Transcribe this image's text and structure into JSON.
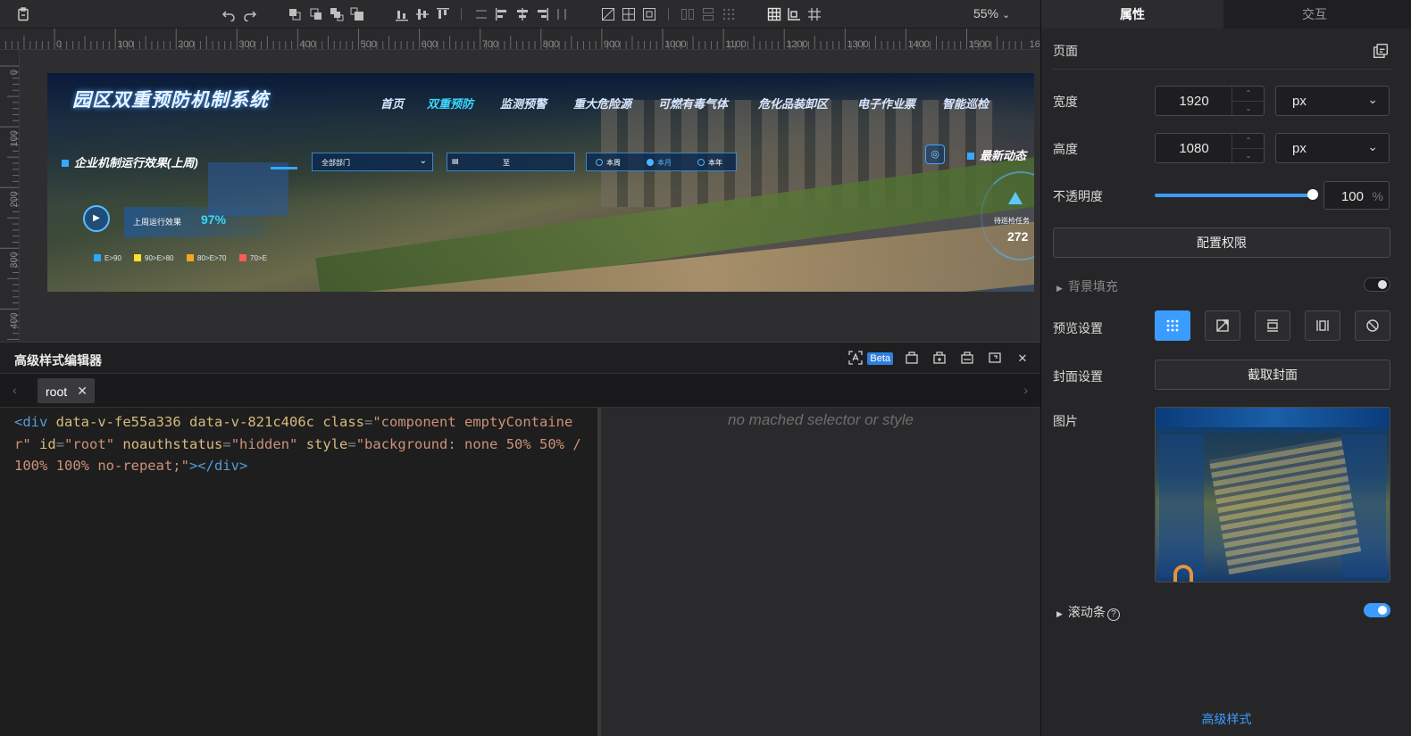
{
  "toolbar": {
    "zoom": "55%"
  },
  "ruler": {
    "top_labels": [
      "0",
      "100",
      "200",
      "300",
      "400",
      "500",
      "600",
      "700",
      "800",
      "900",
      "1000",
      "1100",
      "1200",
      "1300",
      "1400",
      "1500",
      "16"
    ],
    "left_labels": [
      "0",
      "100",
      "200",
      "300",
      "400"
    ]
  },
  "screen": {
    "title": "园区双重预防机制系统",
    "nav": [
      "首页",
      "双重预防",
      "监测预警",
      "重大危险源",
      "可燃有毒气体",
      "危化品装卸区",
      "电子作业票",
      "智能巡检"
    ],
    "nav_active": "双重预防",
    "section_left": "企业机制运行效果(上周)",
    "dept_select": "全部部门",
    "date_sep": "至",
    "radios": [
      "本周",
      "本月",
      "本年"
    ],
    "radio_selected": "本月",
    "effect_label": "上周运行效果",
    "effect_value": "97%",
    "legend": [
      "E>90",
      "90>E>80",
      "80>E>70",
      "70>E"
    ],
    "legend_colors": [
      "#2aa8ff",
      "#ffe02a",
      "#f5a623",
      "#ff5a5a"
    ],
    "section_right": "最新动态",
    "pending_label": "待巡检任务",
    "pending_value": "272"
  },
  "editor": {
    "title": "高级样式编辑器",
    "beta": "Beta",
    "tab": "root",
    "code": {
      "tag_open": "<div",
      "attrs": [
        {
          "name": "data-v-fe55a336",
          "value": null
        },
        {
          "name": "data-v-821c406c",
          "value": null
        },
        {
          "name": "class",
          "value": "\"component emptyContainer\""
        },
        {
          "name": "id",
          "value": "\"root\""
        },
        {
          "name": "noauthstatus",
          "value": "\"hidden\""
        },
        {
          "name": "style",
          "value": "\"background: none 50% 50% / 100% 100% no-repeat;\""
        }
      ],
      "tag_close": "></div>"
    },
    "style_empty": "no mached selector or style"
  },
  "panel": {
    "tabs": [
      "属性",
      "交互"
    ],
    "active_tab": "属性",
    "page_label": "页面",
    "width_label": "宽度",
    "width_value": "1920",
    "width_unit": "px",
    "height_label": "高度",
    "height_value": "1080",
    "height_unit": "px",
    "opacity_label": "不透明度",
    "opacity_value": "100",
    "opacity_unit": "%",
    "opacity_level": 1.0,
    "permission_button": "配置权限",
    "bg_fill_label": "背景填充",
    "bg_fill_enabled": false,
    "preview_label": "预览设置",
    "preview_modes": [
      "grid-fit-icon",
      "stretch-icon",
      "fit-width-icon",
      "fit-height-icon",
      "no-scale-icon"
    ],
    "preview_selected": 0,
    "cover_label": "封面设置",
    "cover_button": "截取封面",
    "image_label": "图片",
    "scrollbar_label": "滚动条",
    "scrollbar_enabled": true,
    "advanced_link": "高级样式"
  },
  "colors": {
    "accent": "#3b9cff",
    "bg": "#232325"
  }
}
